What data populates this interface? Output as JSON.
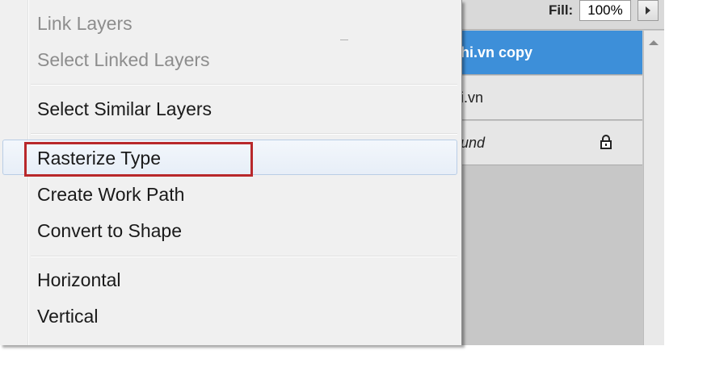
{
  "layers_panel": {
    "fill_label": "Fill:",
    "fill_value": "100%",
    "layers": [
      {
        "name": "hi.vn copy",
        "selected": true
      },
      {
        "name": "i.vn",
        "selected": false
      },
      {
        "name": "und",
        "selected": false,
        "locked": true
      }
    ]
  },
  "context_menu": {
    "items": [
      {
        "label": "Link Layers",
        "enabled": false
      },
      {
        "label": "Select Linked Layers",
        "enabled": false
      },
      {
        "label": "Select Similar Layers",
        "enabled": true
      },
      {
        "label": "Rasterize Type",
        "enabled": true,
        "highlighted": true
      },
      {
        "label": "Create Work Path",
        "enabled": true
      },
      {
        "label": "Convert to Shape",
        "enabled": true
      },
      {
        "label": "Horizontal",
        "enabled": true
      },
      {
        "label": "Vertical",
        "enabled": true
      }
    ]
  },
  "colors": {
    "selected_layer": "#3d8fd9",
    "highlight_border": "#b8282b",
    "menu_background": "#f0f0f0"
  }
}
